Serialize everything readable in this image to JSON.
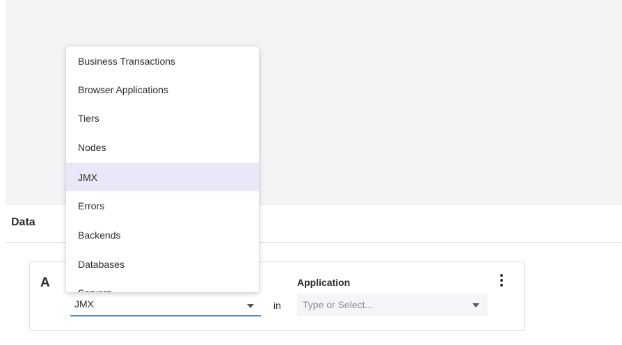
{
  "data_panel": {
    "title": "Data"
  },
  "query": {
    "letter": "A",
    "metric_type": {
      "value": "JMX"
    },
    "connector": "in",
    "application": {
      "label": "Application",
      "placeholder": "Type or Select..."
    }
  },
  "dropdown": {
    "selected_index": 4,
    "items": [
      {
        "label": "Business Transactions"
      },
      {
        "label": "Browser Applications"
      },
      {
        "label": "Tiers"
      },
      {
        "label": "Nodes"
      },
      {
        "label": "JMX"
      },
      {
        "label": "Errors"
      },
      {
        "label": "Backends"
      },
      {
        "label": "Databases"
      },
      {
        "label": "Servers"
      }
    ]
  },
  "icons": {
    "metric_caret": "chevron-down-icon",
    "application_caret": "chevron-down-icon",
    "more_options": "more-vertical-icon"
  },
  "colors": {
    "selected_item_background": "#e9e7f8",
    "underline_accent": "#5b8fc4",
    "panel_background": "#f4f4f6"
  }
}
